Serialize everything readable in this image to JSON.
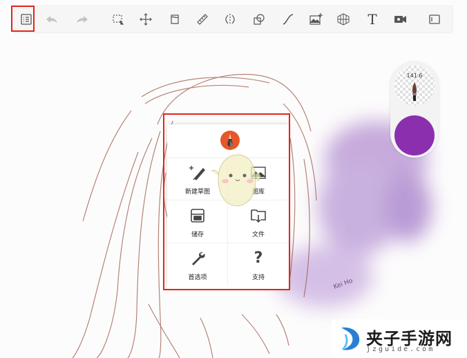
{
  "toolbar": {
    "tools": [
      {
        "name": "layer-list-icon"
      },
      {
        "name": "undo-icon"
      },
      {
        "name": "redo-icon"
      },
      {
        "name": "selection-icon"
      },
      {
        "name": "move-icon"
      },
      {
        "name": "fill-icon"
      },
      {
        "name": "ruler-icon"
      },
      {
        "name": "symmetry-icon"
      },
      {
        "name": "shape-icon"
      },
      {
        "name": "curve-icon"
      },
      {
        "name": "import-image-icon"
      },
      {
        "name": "perspective-icon"
      },
      {
        "name": "text-icon",
        "glyph": "T"
      },
      {
        "name": "record-icon"
      },
      {
        "name": "fullscreen-icon"
      }
    ]
  },
  "brush": {
    "size": "141.6",
    "color": "#8b2fae"
  },
  "menu": {
    "items": [
      {
        "label": "新建草图",
        "icon": "new-sketch-icon"
      },
      {
        "label": "图库",
        "icon": "gallery-icon"
      },
      {
        "label": "储存",
        "icon": "save-icon"
      },
      {
        "label": "文件",
        "icon": "file-icon"
      },
      {
        "label": "首选项",
        "icon": "preferences-icon"
      },
      {
        "label": "支持",
        "icon": "support-icon",
        "glyph": "?"
      }
    ]
  },
  "watermark": {
    "title": "夹子手游网",
    "subtitle": "jzguide.com"
  },
  "colors": {
    "accent_purple": "#8b2fae",
    "highlight_red": "#e3241b"
  }
}
